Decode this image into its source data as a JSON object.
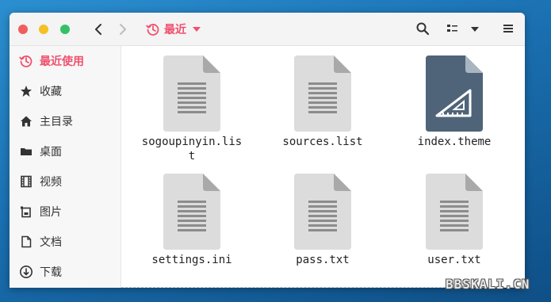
{
  "toolbar": {
    "location_label": "最近",
    "location_icon": "clock-history-icon"
  },
  "sidebar": {
    "items": [
      {
        "label": "最近使用",
        "icon": "clock-history-icon",
        "active": true
      },
      {
        "label": "收藏",
        "icon": "star-icon"
      },
      {
        "label": "主目录",
        "icon": "home-icon"
      },
      {
        "label": "桌面",
        "icon": "folder-icon"
      },
      {
        "label": "视频",
        "icon": "film-icon"
      },
      {
        "label": "图片",
        "icon": "picture-icon"
      },
      {
        "label": "文档",
        "icon": "document-icon"
      },
      {
        "label": "下载",
        "icon": "download-icon"
      }
    ]
  },
  "files": [
    {
      "name": "sogoupinyin.list",
      "type": "text"
    },
    {
      "name": "sources.list",
      "type": "text"
    },
    {
      "name": "index.theme",
      "type": "theme"
    },
    {
      "name": "settings.ini",
      "type": "text"
    },
    {
      "name": "pass.txt",
      "type": "text"
    },
    {
      "name": "user.txt",
      "type": "text"
    }
  ],
  "watermark": "BBSKALI.CN",
  "colors": {
    "accent": "#f0506e",
    "doc_gray": "#dcdcdc",
    "theme_slate": "#4f6478"
  }
}
